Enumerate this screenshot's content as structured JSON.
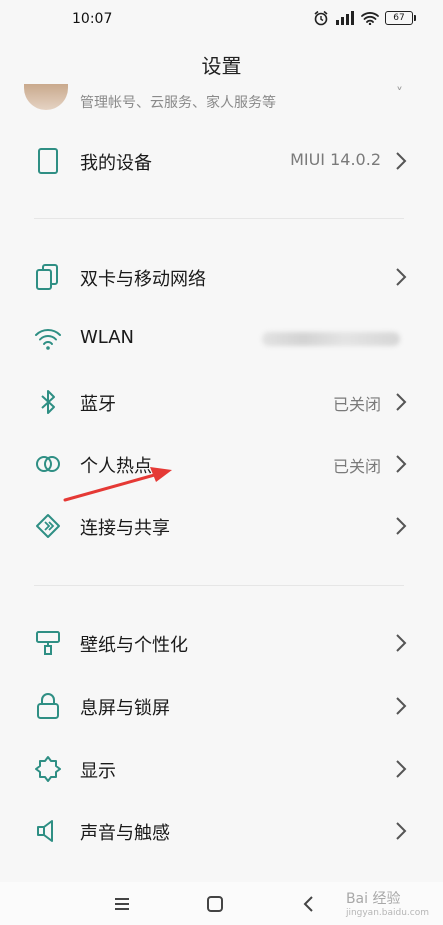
{
  "status": {
    "time": "10:07",
    "battery": "67"
  },
  "header": {
    "title": "设置"
  },
  "account": {
    "subtitle": "管理帐号、云服务、家人服务等"
  },
  "my_device": {
    "label": "我的设备",
    "value": "MIUI 14.0.2"
  },
  "network": [
    {
      "label": "双卡与移动网络",
      "value": ""
    },
    {
      "label": "WLAN",
      "value": ""
    },
    {
      "label": "蓝牙",
      "value": "已关闭"
    },
    {
      "label": "个人热点",
      "value": "已关闭"
    },
    {
      "label": "连接与共享",
      "value": ""
    }
  ],
  "personal": [
    {
      "label": "壁纸与个性化"
    },
    {
      "label": "息屏与锁屏"
    },
    {
      "label": "显示"
    },
    {
      "label": "声音与触感"
    }
  ],
  "watermark": {
    "text": "Bai 经验",
    "sub": "jingyan.baidu.com"
  },
  "colors": {
    "accent": "#2f8f84",
    "annotation_arrow": "#e53935"
  }
}
